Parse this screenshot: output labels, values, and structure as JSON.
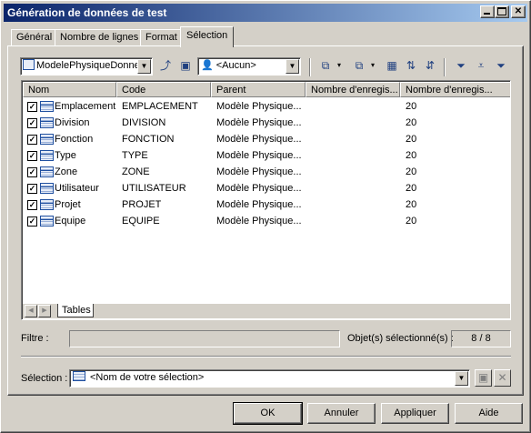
{
  "window": {
    "title": "Génération de données de test"
  },
  "tabs": [
    {
      "label": "Général"
    },
    {
      "label": "Nombre de lignes"
    },
    {
      "label": "Format"
    },
    {
      "label": "Sélection"
    }
  ],
  "toolbar": {
    "model_combo": "ModelePhysiqueDonnee",
    "filter_combo": "<Aucun>"
  },
  "grid": {
    "columns": [
      "Nom",
      "Code",
      "Parent",
      "Nombre d'enregis...",
      "Nombre d'enregis..."
    ],
    "rows": [
      {
        "name": "Emplacement",
        "code": "EMPLACEMENT",
        "parent": "Modèle Physique...",
        "count1": "",
        "count2": "20",
        "checked": true
      },
      {
        "name": "Division",
        "code": "DIVISION",
        "parent": "Modèle Physique...",
        "count1": "",
        "count2": "20",
        "checked": true
      },
      {
        "name": "Fonction",
        "code": "FONCTION",
        "parent": "Modèle Physique...",
        "count1": "",
        "count2": "20",
        "checked": true
      },
      {
        "name": "Type",
        "code": "TYPE",
        "parent": "Modèle Physique...",
        "count1": "",
        "count2": "20",
        "checked": true
      },
      {
        "name": "Zone",
        "code": "ZONE",
        "parent": "Modèle Physique...",
        "count1": "",
        "count2": "20",
        "checked": true
      },
      {
        "name": "Utilisateur",
        "code": "UTILISATEUR",
        "parent": "Modèle Physique...",
        "count1": "",
        "count2": "20",
        "checked": true
      },
      {
        "name": "Projet",
        "code": "PROJET",
        "parent": "Modèle Physique...",
        "count1": "",
        "count2": "20",
        "checked": true
      },
      {
        "name": "Equipe",
        "code": "EQUIPE",
        "parent": "Modèle Physique...",
        "count1": "",
        "count2": "20",
        "checked": true
      }
    ],
    "sheet_tab": "Tables"
  },
  "filter": {
    "label": "Filtre :",
    "value": ""
  },
  "selected_count": {
    "label": "Objet(s) sélectionné(s) :",
    "value": "8 / 8"
  },
  "selection": {
    "label": "Sélection :",
    "value": "<Nom de votre sélection>"
  },
  "buttons": {
    "ok": "OK",
    "cancel": "Annuler",
    "apply": "Appliquer",
    "help": "Aide"
  }
}
